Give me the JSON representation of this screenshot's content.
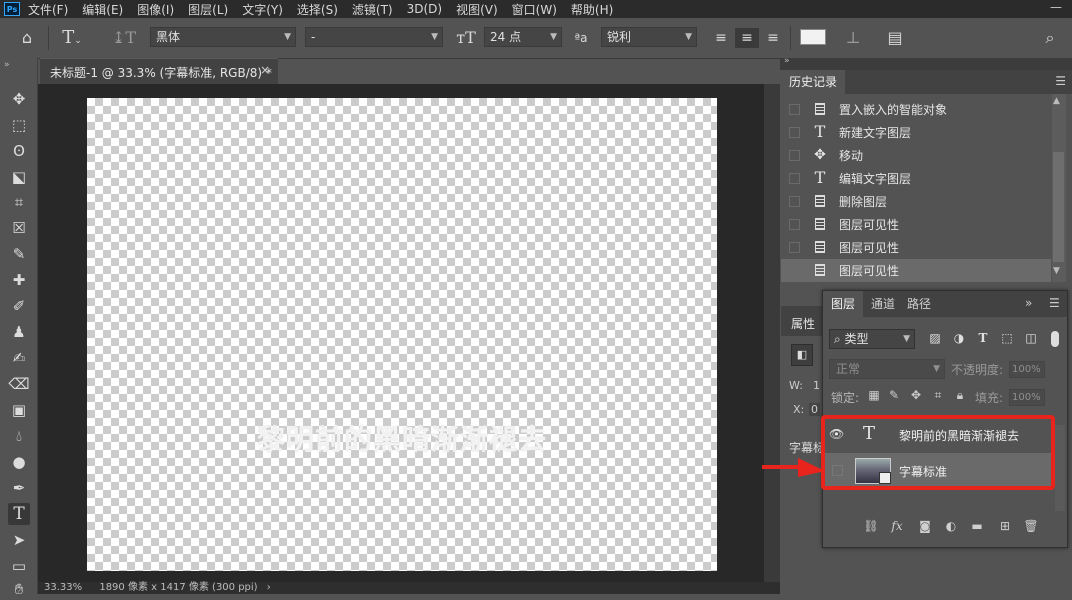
{
  "menu": [
    "文件(F)",
    "编辑(E)",
    "图像(I)",
    "图层(L)",
    "文字(Y)",
    "选择(S)",
    "滤镜(T)",
    "3D(D)",
    "视图(V)",
    "窗口(W)",
    "帮助(H)"
  ],
  "app_logo": "Ps",
  "window_minimize": "—",
  "options_bar": {
    "font_family": "黑体",
    "font_style": "-",
    "font_size": "24 点",
    "antialias_label": "ªa",
    "antialias": "锐利",
    "text_color": "#f2f2f2"
  },
  "document": {
    "tab_label": "未标题-1 @ 33.3% (字幕标准, RGB/8) *",
    "close": "×",
    "canvas_text": "黎明前的黑暗渐渐褪去",
    "status_zoom": "33.33%",
    "status_info": "1890 像素 x 1417 像素 (300 ppi)"
  },
  "history": {
    "tab": "历史记录",
    "items": [
      {
        "icon": "doc",
        "label": "置入嵌入的智能对象"
      },
      {
        "icon": "T",
        "label": "新建文字图层"
      },
      {
        "icon": "move",
        "label": "移动"
      },
      {
        "icon": "T",
        "label": "编辑文字图层"
      },
      {
        "icon": "doc",
        "label": "删除图层"
      },
      {
        "icon": "doc",
        "label": "图层可见性"
      },
      {
        "icon": "doc",
        "label": "图层可见性"
      },
      {
        "icon": "doc",
        "label": "图层可见性"
      }
    ]
  },
  "properties": {
    "tab": "属性",
    "w_label": "W:",
    "w_value": "1",
    "x_label": "X:",
    "x_value": "0",
    "section": "字幕标"
  },
  "layers": {
    "tabs": [
      "图层",
      "通道",
      "路径"
    ],
    "filter": "类型",
    "blend_mode": "正常",
    "opacity_label": "不透明度:",
    "opacity_value": "100%",
    "lock_label": "锁定:",
    "fill_label": "填充:",
    "fill_value": "100%",
    "items": [
      {
        "name": "黎明前的黑暗渐渐褪去",
        "type": "text",
        "visible": true
      },
      {
        "name": "字幕标准",
        "type": "smart-object",
        "visible": false
      }
    ],
    "footer_fx": "fx"
  },
  "colors": {
    "highlight": "#e8241c",
    "panel_bg": "#535353",
    "selected_row": "#6a6a6a"
  }
}
